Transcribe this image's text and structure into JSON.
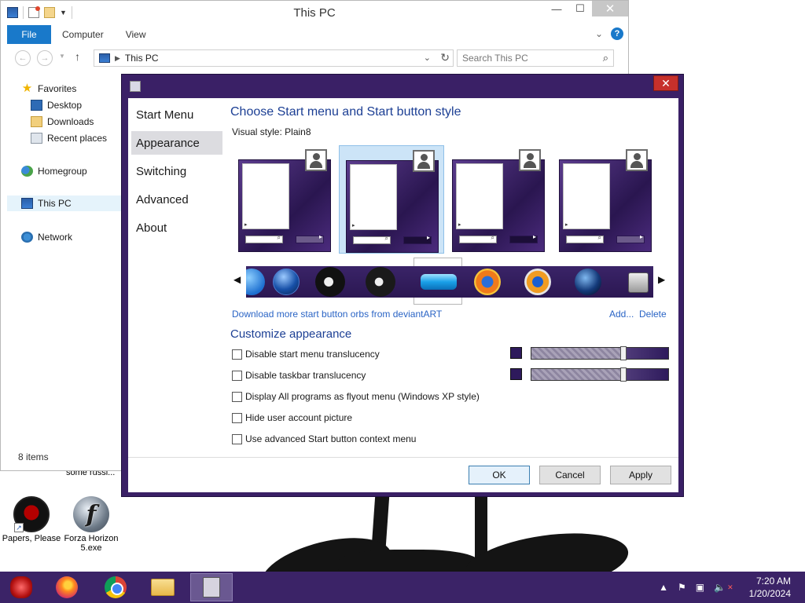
{
  "explorer": {
    "title": "This PC",
    "ribbon_tabs": [
      "File",
      "Computer",
      "View"
    ],
    "address": "This PC",
    "search_placeholder": "Search This PC",
    "nav": {
      "favorites": "Favorites",
      "desktop": "Desktop",
      "downloads": "Downloads",
      "recent": "Recent places",
      "homegroup": "Homegroup",
      "this_pc": "This PC",
      "network": "Network"
    },
    "status": "8 items"
  },
  "dialog": {
    "sidebar": [
      "Start Menu",
      "Appearance",
      "Switching",
      "Advanced",
      "About"
    ],
    "active_tab": "Appearance",
    "heading": "Choose Start menu and Start button style",
    "visual_style_label": "Visual style:",
    "visual_style_value": "Plain8",
    "download_link": "Download more start button orbs from deviantART",
    "add_link": "Add...",
    "delete_link": "Delete",
    "customize_heading": "Customize appearance",
    "options": [
      "Disable start menu translucency",
      "Disable taskbar translucency",
      "Display All programs as flyout menu (Windows XP style)",
      "Hide user account picture",
      "Use advanced Start button context menu"
    ],
    "translucency_levels": [
      0.67,
      0.67
    ],
    "accent_color": "#2e1a5c",
    "buttons": {
      "ok": "OK",
      "cancel": "Cancel",
      "apply": "Apply"
    }
  },
  "desktop": {
    "clipped_label": "some russi...",
    "icons": [
      {
        "name": "Papers, Please",
        "icon": "papers-please-icon"
      },
      {
        "name": "Forza Horizon 5.exe",
        "icon": "flash-file-icon"
      }
    ]
  },
  "taskbar": {
    "apps": [
      "start-orb",
      "firefox",
      "chrome",
      "file-explorer",
      "classic-shell-settings"
    ],
    "time": "7:20 AM",
    "date": "1/20/2024",
    "color": "#3b2367"
  }
}
